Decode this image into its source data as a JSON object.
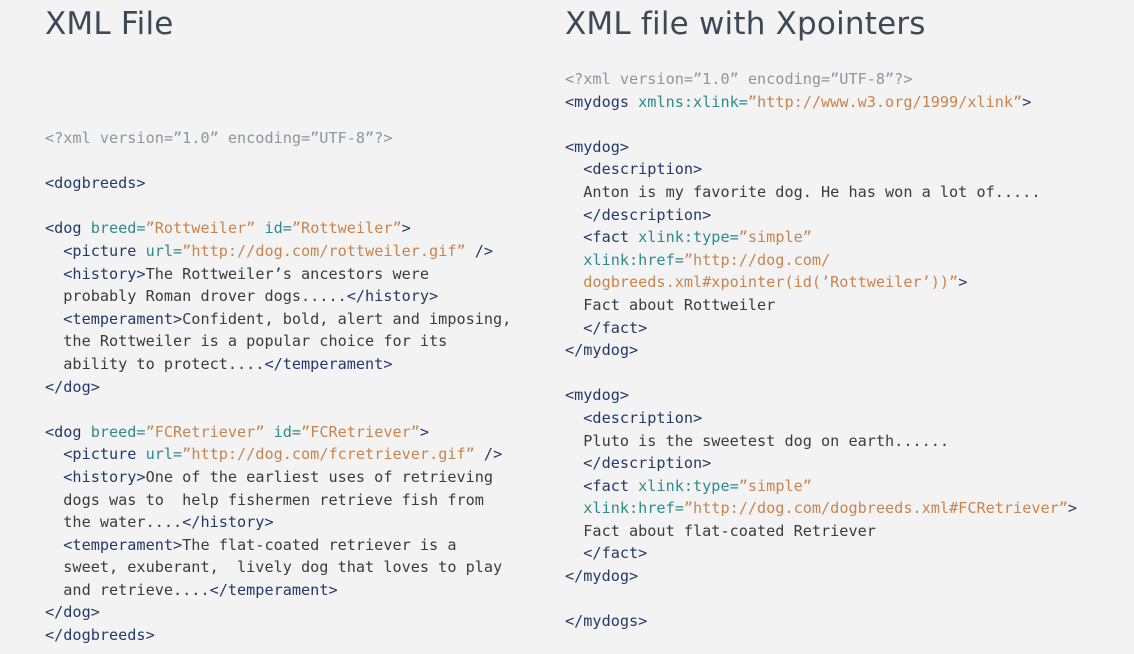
{
  "left": {
    "heading": "XML File",
    "lines": [
      [
        {
          "s": "p",
          "t": "<?xml version=”1.0” encoding=”UTF-8”?>"
        }
      ],
      [],
      [
        {
          "s": "t",
          "t": "<dogbreeds>"
        }
      ],
      [],
      [
        {
          "s": "t",
          "t": "<dog "
        },
        {
          "s": "a",
          "t": "breed="
        },
        {
          "s": "v",
          "t": "”Rottweiler”"
        },
        {
          "s": "a",
          "t": " id="
        },
        {
          "s": "v",
          "t": "”Rottweiler”"
        },
        {
          "s": "t",
          "t": ">"
        }
      ],
      [
        {
          "s": "t",
          "t": "  <picture "
        },
        {
          "s": "a",
          "t": "url="
        },
        {
          "s": "v",
          "t": "”http://dog.com/rottweiler.gif”"
        },
        {
          "s": "t",
          "t": " />"
        }
      ],
      [
        {
          "s": "t",
          "t": "  <history>"
        },
        {
          "s": "x",
          "t": "The Rottweiler’s ancestors were"
        }
      ],
      [
        {
          "s": "x",
          "t": "  probably Roman drover dogs....."
        },
        {
          "s": "t",
          "t": "</history>"
        }
      ],
      [
        {
          "s": "t",
          "t": "  <temperament>"
        },
        {
          "s": "x",
          "t": "Confident, bold, alert and imposing,"
        }
      ],
      [
        {
          "s": "x",
          "t": "  the Rottweiler is a popular choice for its"
        }
      ],
      [
        {
          "s": "x",
          "t": "  ability to protect...."
        },
        {
          "s": "t",
          "t": "</temperament>"
        }
      ],
      [
        {
          "s": "t",
          "t": "</dog>"
        }
      ],
      [],
      [
        {
          "s": "t",
          "t": "<dog "
        },
        {
          "s": "a",
          "t": "breed="
        },
        {
          "s": "v",
          "t": "”FCRetriever”"
        },
        {
          "s": "a",
          "t": " id="
        },
        {
          "s": "v",
          "t": "”FCRetriever”"
        },
        {
          "s": "t",
          "t": ">"
        }
      ],
      [
        {
          "s": "t",
          "t": "  <picture "
        },
        {
          "s": "a",
          "t": "url="
        },
        {
          "s": "v",
          "t": "”http://dog.com/fcretriever.gif”"
        },
        {
          "s": "t",
          "t": " />"
        }
      ],
      [
        {
          "s": "t",
          "t": "  <history>"
        },
        {
          "s": "x",
          "t": "One of the earliest uses of retrieving"
        }
      ],
      [
        {
          "s": "x",
          "t": "  dogs was to  help fishermen retrieve fish from"
        }
      ],
      [
        {
          "s": "x",
          "t": "  the water...."
        },
        {
          "s": "t",
          "t": "</history>"
        }
      ],
      [
        {
          "s": "t",
          "t": "  <temperament>"
        },
        {
          "s": "x",
          "t": "The flat-coated retriever is a"
        }
      ],
      [
        {
          "s": "x",
          "t": "  sweet, exuberant,  lively dog that loves to play"
        }
      ],
      [
        {
          "s": "x",
          "t": "  and retrieve...."
        },
        {
          "s": "t",
          "t": "</temperament>"
        }
      ],
      [
        {
          "s": "t",
          "t": "</dog>"
        }
      ],
      [
        {
          "s": "t",
          "t": "</dogbreeds>"
        }
      ]
    ]
  },
  "right": {
    "heading": "XML file with Xpointers",
    "lines": [
      [
        {
          "s": "p",
          "t": "<?xml version=”1.0” encoding=”UTF-8”?>"
        }
      ],
      [
        {
          "s": "t",
          "t": "<mydogs "
        },
        {
          "s": "a",
          "t": "xmlns:xlink="
        },
        {
          "s": "v",
          "t": "”http://www.w3.org/1999/xlink”"
        },
        {
          "s": "t",
          "t": ">"
        }
      ],
      [],
      [
        {
          "s": "t",
          "t": "<mydog>"
        }
      ],
      [
        {
          "s": "t",
          "t": "  <description>"
        }
      ],
      [
        {
          "s": "x",
          "t": "  Anton is my favorite dog. He has won a lot of....."
        }
      ],
      [
        {
          "s": "t",
          "t": "  </description>"
        }
      ],
      [
        {
          "s": "t",
          "t": "  <fact "
        },
        {
          "s": "a",
          "t": "xlink:type="
        },
        {
          "s": "v",
          "t": "”simple”"
        }
      ],
      [
        {
          "s": "a",
          "t": "  xlink:href="
        },
        {
          "s": "v",
          "t": "”http://dog.com/"
        }
      ],
      [
        {
          "s": "v",
          "t": "  dogbreeds.xml#xpointer(id(’Rottweiler’))”"
        },
        {
          "s": "t",
          "t": ">"
        }
      ],
      [
        {
          "s": "x",
          "t": "  Fact about Rottweiler"
        }
      ],
      [
        {
          "s": "t",
          "t": "  </fact>"
        }
      ],
      [
        {
          "s": "t",
          "t": "</mydog>"
        }
      ],
      [],
      [
        {
          "s": "t",
          "t": "<mydog>"
        }
      ],
      [
        {
          "s": "t",
          "t": "  <description>"
        }
      ],
      [
        {
          "s": "x",
          "t": "  Pluto is the sweetest dog on earth......"
        }
      ],
      [
        {
          "s": "t",
          "t": "  </description>"
        }
      ],
      [
        {
          "s": "t",
          "t": "  <fact "
        },
        {
          "s": "a",
          "t": "xlink:type="
        },
        {
          "s": "v",
          "t": "”simple”"
        }
      ],
      [
        {
          "s": "a",
          "t": "  xlink:href="
        },
        {
          "s": "v",
          "t": "”http://dog.com/dogbreeds.xml#FCRetriever”"
        },
        {
          "s": "t",
          "t": ">"
        }
      ],
      [
        {
          "s": "x",
          "t": "  Fact about flat-coated Retriever"
        }
      ],
      [
        {
          "s": "t",
          "t": "  </fact>"
        }
      ],
      [
        {
          "s": "t",
          "t": "</mydog>"
        }
      ],
      [],
      [
        {
          "s": "t",
          "t": "</mydogs>"
        }
      ]
    ]
  }
}
